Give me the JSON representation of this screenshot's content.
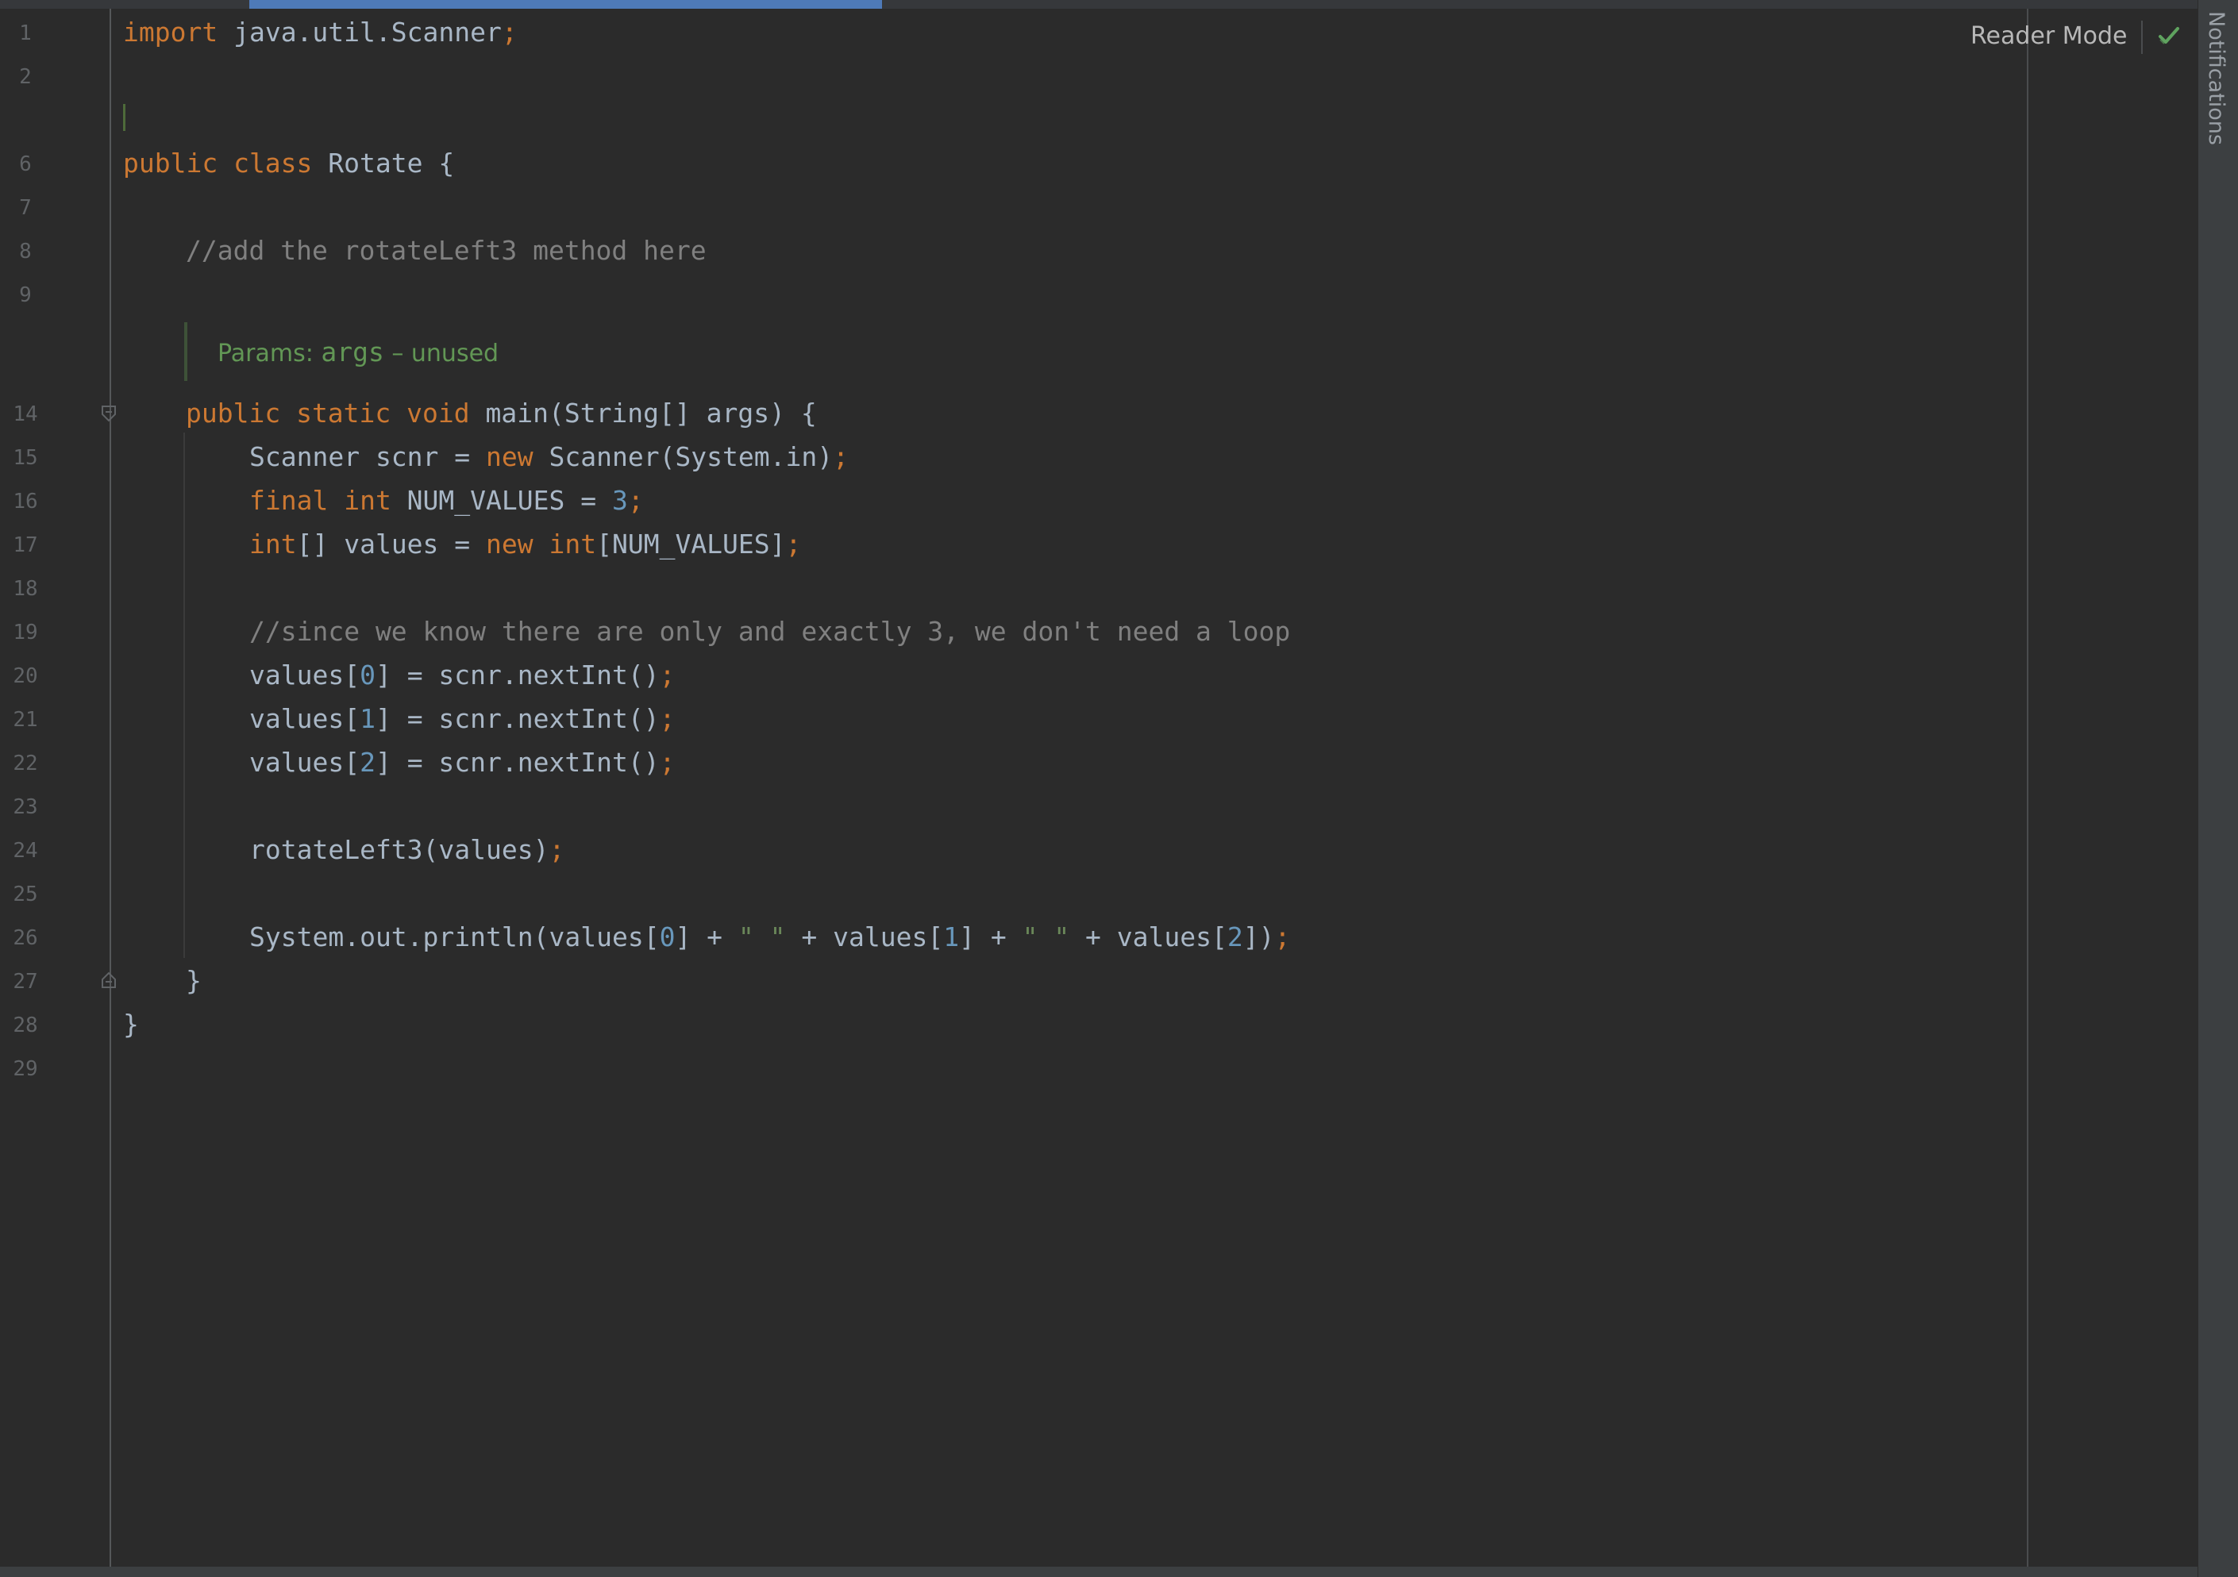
{
  "editor": {
    "reader_mode_label": "Reader Mode",
    "notifications_label": "Notifications",
    "status_icon": "check-icon",
    "inlay_hint": {
      "prefix": "Params: ",
      "arg": "args",
      "suffix": " – unused"
    },
    "line_numbers": [
      "1",
      "2",
      "6",
      "7",
      "8",
      "9",
      "14",
      "15",
      "16",
      "17",
      "18",
      "19",
      "20",
      "21",
      "22",
      "23",
      "24",
      "25",
      "26",
      "27",
      "28",
      "29"
    ],
    "code": {
      "l1": "import java.util.Scanner;",
      "l6": "public class Rotate {",
      "l8": "//add the rotateLeft3 method here",
      "l14": "public static void main(String[] args) {",
      "l15": "Scanner scnr = new Scanner(System.in);",
      "l16": "final int NUM_VALUES = 3;",
      "l17": "int[] values = new int[NUM_VALUES];",
      "l19": "//since we know there are only and exactly 3, we don't need a loop",
      "l20": "values[0] = scnr.nextInt();",
      "l21": "values[1] = scnr.nextInt();",
      "l22": "values[2] = scnr.nextInt();",
      "l24": "rotateLeft3(values);",
      "l26": "System.out.println(values[0] + \" \" + values[1] + \" \" + values[2]);",
      "l27": "}",
      "l28": "}"
    },
    "colors": {
      "background": "#2b2b2b",
      "keyword": "#cc7832",
      "number": "#6897bb",
      "string": "#6a8759",
      "comment": "#808080",
      "default": "#a9b7c6",
      "doc": "#629755"
    }
  }
}
